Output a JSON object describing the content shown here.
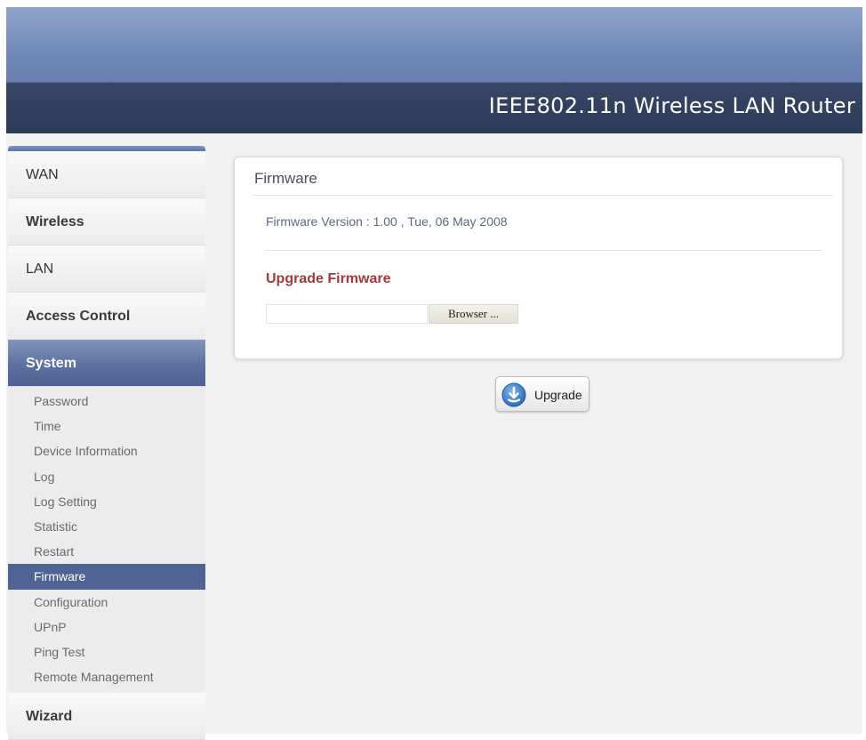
{
  "header": {
    "title": "IEEE802.11n  Wireless LAN Router"
  },
  "sidebar": {
    "menu": [
      {
        "label": "WAN"
      },
      {
        "label": "Wireless"
      },
      {
        "label": "LAN"
      },
      {
        "label": "Access Control"
      },
      {
        "label": "System"
      }
    ],
    "submenu": [
      {
        "label": "Password"
      },
      {
        "label": "Time"
      },
      {
        "label": "Device Information"
      },
      {
        "label": "Log"
      },
      {
        "label": "Log Setting"
      },
      {
        "label": "Statistic"
      },
      {
        "label": "Restart"
      },
      {
        "label": "Firmware"
      },
      {
        "label": "Configuration"
      },
      {
        "label": "UPnP"
      },
      {
        "label": "Ping Test"
      },
      {
        "label": "Remote Management"
      }
    ],
    "wizard": {
      "label": "Wizard"
    },
    "active_menu": "System",
    "active_submenu": "Firmware"
  },
  "panel": {
    "title": "Firmware",
    "firmware_version": "Firmware Version : 1.00 , Tue, 06 May 2008",
    "upgrade_heading": "Upgrade Firmware",
    "file_input_value": "",
    "browse_label": "Browser ..."
  },
  "actions": {
    "upgrade_label": "Upgrade",
    "upgrade_icon": "download-arrow-icon"
  },
  "colors": {
    "header_bar": "#2c3a57",
    "active_item": "#4f6492",
    "heading_red": "#a33a3a"
  }
}
